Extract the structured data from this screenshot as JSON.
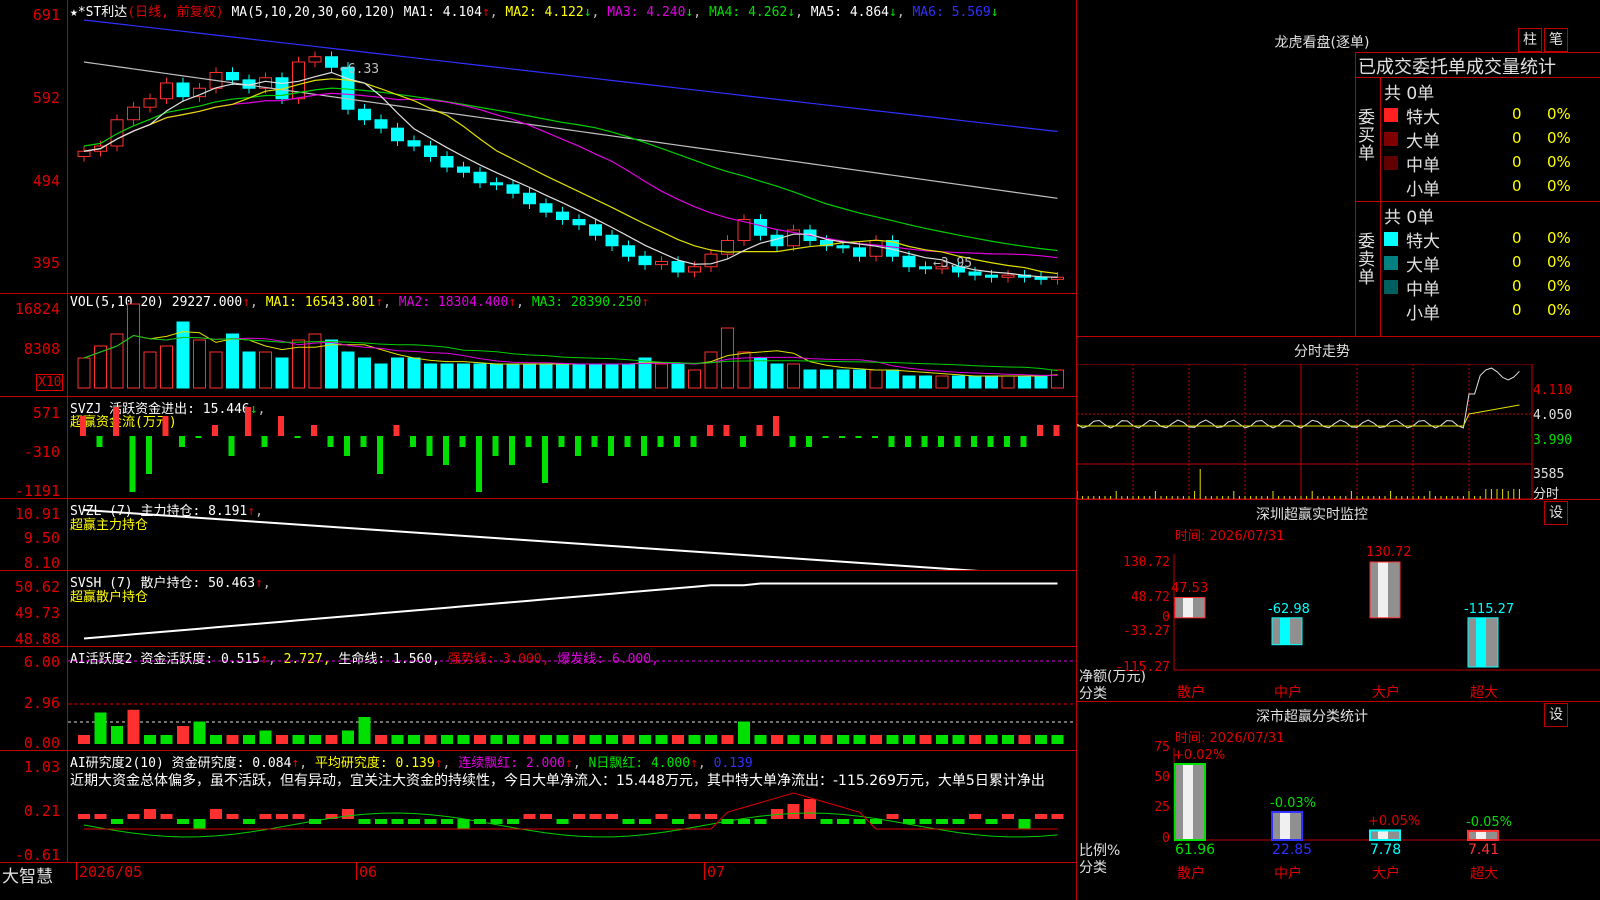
{
  "main_header": {
    "stock": "*ST利达",
    "mode": "(日线, 前复权)",
    "ma_label": "MA(5,10,20,30,60,120)",
    "ma1": "MA1: 4.104",
    "ma2": "MA2: 4.122",
    "ma3": "MA3: 4.240",
    "ma4": "MA4: 4.262",
    "ma5": "MA5: 4.864",
    "ma6": "MA6: 5.569"
  },
  "price_axis": [
    "691",
    "592",
    "494",
    "395"
  ],
  "price_annotations": {
    "high": "6.33",
    "low": "3.95"
  },
  "vol_panel": {
    "label": "VOL(5,10,20)",
    "value": "29227.000",
    "ma1": "MA1: 16543.801",
    "ma2": "MA2: 18304.400",
    "ma3": "MA3: 28390.250",
    "axis": [
      "16824",
      "8308"
    ],
    "unit": "X10"
  },
  "svzj_panel": {
    "label": "SVZJ",
    "text": "活跃资金进出: 15.446",
    "sub": "超赢资金流(万元)",
    "axis": [
      "571",
      "-310",
      "-1191"
    ]
  },
  "svzl_panel": {
    "label": "SVZL (7)",
    "text": "主力持仓: 8.191",
    "sub": "超赢主力持仓",
    "axis": [
      "10.91",
      "9.50",
      "8.10"
    ]
  },
  "svsh_panel": {
    "label": "SVSH (7)",
    "text": "散户持仓: 50.463",
    "sub": "超赢散户持仓",
    "axis": [
      "50.62",
      "49.73",
      "48.88"
    ]
  },
  "ai_active_panel": {
    "label": "AI活跃度2",
    "text1": "资金活跃度: 0.515",
    "text2": "2.727,",
    "text3": "生命线: 1.560,",
    "text4": "强势线: 3.000,",
    "text5": "爆发线: 6.000,",
    "axis": [
      "6.00",
      "2.96",
      "0.00"
    ]
  },
  "ai_research_panel": {
    "label": "AI研究度2(10)",
    "text1": "资金研究度: 0.084",
    "text2": "平均研究度: 0.139",
    "text3": "连续飘红: 2.000",
    "text4": "N日飘红: 4.000",
    "text5": "0.139",
    "comment": "近期大资金总体偏多，虽不活跃，但有异动，宜关注大资金的持续性，今日大单净流入：15.448万元，其中特大单净流出：-115.269万元，大单5日累计净出",
    "axis": [
      "1.03",
      "0.21",
      "-0.61"
    ]
  },
  "date_axis": {
    "brand": "大智慧",
    "d1": "2026/05",
    "d2": "06",
    "d3": "07"
  },
  "right_panel": {
    "title": "龙虎看盘(逐单)",
    "btn1": "柱",
    "btn2": "笔",
    "stats_header": "已成交委托单成交量统计",
    "buy_label": "委买单",
    "sell_label": "委卖单",
    "buy_total": "共 0单",
    "sell_total": "共 0单",
    "buy_rows": [
      {
        "name": "特大",
        "count": "0",
        "pct": "0%"
      },
      {
        "name": "大单",
        "count": "0",
        "pct": "0%"
      },
      {
        "name": "中单",
        "count": "0",
        "pct": "0%"
      },
      {
        "name": "小单",
        "count": "0",
        "pct": "0%"
      }
    ],
    "sell_rows": [
      {
        "name": "特大",
        "count": "0",
        "pct": "0%"
      },
      {
        "name": "大单",
        "count": "0",
        "pct": "0%"
      },
      {
        "name": "中单",
        "count": "0",
        "pct": "0%"
      },
      {
        "name": "小单",
        "count": "0",
        "pct": "0%"
      }
    ],
    "intraday_title": "分时走势",
    "intraday_axis": [
      "4.110",
      "4.050",
      "3.990"
    ],
    "intraday_vol": "3585",
    "intraday_vol_unit": "分时",
    "monitor_title": "深圳超赢实时监控",
    "monitor_btn": "设",
    "monitor_time": "时间: 2026/07/31",
    "monitor_axis": [
      "130.72",
      "48.72",
      "0",
      "-33.27",
      "-115.27"
    ],
    "monitor_ylabel": "净额(万元)",
    "monitor_xlabel": "分类",
    "monitor_cats": [
      "散户",
      "中户",
      "大户",
      "超大"
    ],
    "monitor_values": [
      "47.53",
      "-62.98",
      "130.72",
      "-115.27"
    ],
    "class_title": "深市超赢分类统计",
    "class_btn": "设",
    "class_time": "时间: 2026/07/31",
    "class_axis": [
      "75",
      "50",
      "25",
      "0"
    ],
    "class_ylabel": "比例%",
    "class_xlabel": "分类",
    "class_cats": [
      "散户",
      "中户",
      "大户",
      "超大"
    ],
    "class_changes": [
      "+0.02%",
      "-0.03%",
      "+0.05%",
      "-0.05%"
    ],
    "class_values": [
      "61.96",
      "22.85",
      "7.78",
      "7.41"
    ]
  },
  "chart_data": {
    "type": "bar",
    "title": "深圳超赢实时监控",
    "categories": [
      "散户",
      "中户",
      "大户",
      "超大"
    ],
    "values": [
      47.53,
      -62.98,
      130.72,
      -115.27
    ],
    "ylabel": "净额(万元)",
    "xlabel": "分类",
    "ylim": [
      -115.27,
      130.72
    ]
  }
}
